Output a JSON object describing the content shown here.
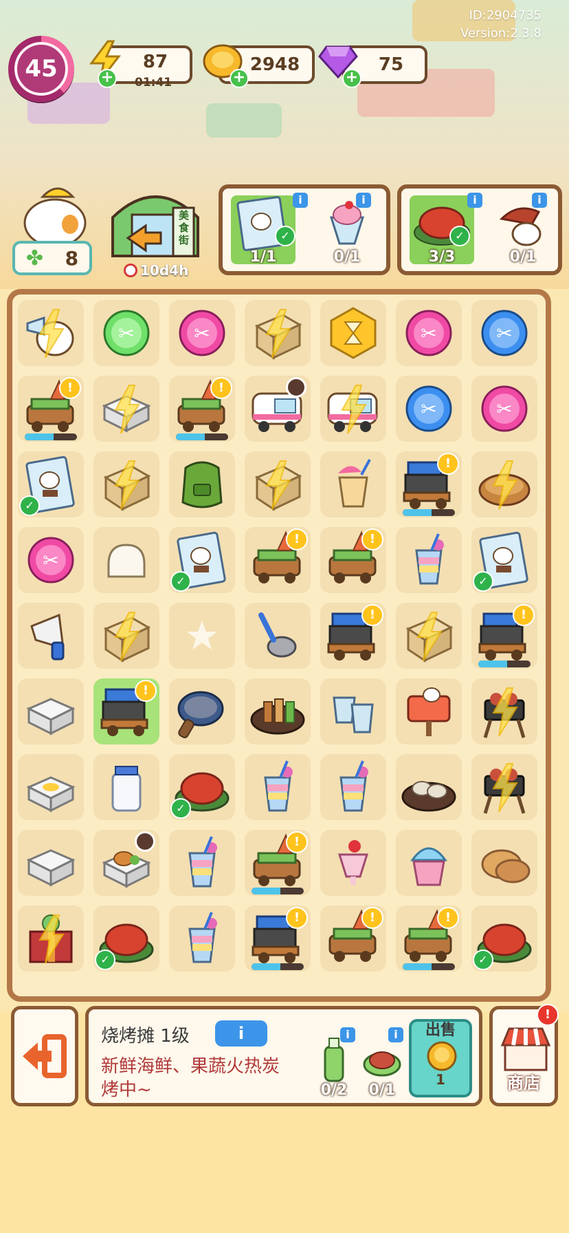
{
  "meta": {
    "player_id": "ID:2904735",
    "version": "Version:2.3.8"
  },
  "top_bar": {
    "level": "45",
    "energy": {
      "value": "87",
      "timer": "01:41"
    },
    "coins": "2948",
    "gems": "75"
  },
  "event": {
    "clover_count": "8",
    "street_label": "美食街",
    "street_timer": "10d4h"
  },
  "orders": [
    {
      "items": [
        {
          "icon": "recipe-card-icon",
          "count": "1/1",
          "complete": true
        },
        {
          "icon": "parfait-icon",
          "count": "0/1",
          "complete": false
        }
      ]
    },
    {
      "items": [
        {
          "icon": "crayfish-plate-icon",
          "count": "3/3",
          "complete": true
        },
        {
          "icon": "duck-skewer-icon",
          "count": "0/1",
          "complete": false
        }
      ]
    }
  ],
  "board": {
    "rows": [
      [
        {
          "item": "megaphone-duck",
          "energy": true
        },
        {
          "item": "green-orb"
        },
        {
          "item": "pink-orb"
        },
        {
          "item": "crate",
          "energy": true
        },
        {
          "item": "hourglass-hex"
        },
        {
          "item": "pink-orb"
        },
        {
          "item": "blue-orb"
        }
      ],
      [
        {
          "item": "bbq-cart",
          "alert": true,
          "progress": true
        },
        {
          "item": "foam-box",
          "energy": true
        },
        {
          "item": "bbq-cart",
          "alert": true,
          "progress": true
        },
        {
          "item": "food-truck",
          "clock": true
        },
        {
          "item": "food-truck",
          "energy": true
        },
        {
          "item": "blue-orb"
        },
        {
          "item": "pink-orb"
        }
      ],
      [
        {
          "item": "recipe-card",
          "check": true
        },
        {
          "item": "crate",
          "energy": true
        },
        {
          "item": "green-apron"
        },
        {
          "item": "crate",
          "energy": true
        },
        {
          "item": "iced-tea"
        },
        {
          "item": "grill-stand",
          "alert": true,
          "progress": true
        },
        {
          "item": "pie",
          "energy": true
        }
      ],
      [
        {
          "item": "pink-orb"
        },
        {
          "item": "bread"
        },
        {
          "item": "recipe-card",
          "check": true
        },
        {
          "item": "bbq-cart",
          "alert": true
        },
        {
          "item": "bbq-cart",
          "alert": true
        },
        {
          "item": "rainbow-drink"
        },
        {
          "item": "recipe-card",
          "check": true
        }
      ],
      [
        {
          "item": "megaphone"
        },
        {
          "item": "crate",
          "energy": true
        },
        {
          "item": "star-empty"
        },
        {
          "item": "ladle"
        },
        {
          "item": "grill-stand",
          "alert": true
        },
        {
          "item": "crate",
          "energy": true
        },
        {
          "item": "grill-stand",
          "alert": true,
          "progress": true
        }
      ],
      [
        {
          "item": "foam-box"
        },
        {
          "item": "grill-stand",
          "alert": true,
          "highlight": true
        },
        {
          "item": "frying-pan"
        },
        {
          "item": "skewer-plate"
        },
        {
          "item": "cups"
        },
        {
          "item": "open-sign"
        },
        {
          "item": "bbq-rack",
          "energy": true
        }
      ],
      [
        {
          "item": "foam-box-egg"
        },
        {
          "item": "milk-jar"
        },
        {
          "item": "crayfish-plate",
          "check": true
        },
        {
          "item": "rainbow-drink"
        },
        {
          "item": "rainbow-drink"
        },
        {
          "item": "oyster-plate"
        },
        {
          "item": "bbq-rack",
          "energy": true
        }
      ],
      [
        {
          "item": "foam-box"
        },
        {
          "item": "foam-box-chicken",
          "clock": true
        },
        {
          "item": "rainbow-drink"
        },
        {
          "item": "bbq-cart",
          "alert": true,
          "progress": true
        },
        {
          "item": "parfait"
        },
        {
          "item": "shaved-ice"
        },
        {
          "item": "buns"
        }
      ],
      [
        {
          "item": "gift-box",
          "energy": true
        },
        {
          "item": "crayfish-plate",
          "check": true
        },
        {
          "item": "rainbow-drink"
        },
        {
          "item": "grill-stand",
          "alert": true,
          "progress": true
        },
        {
          "item": "bbq-cart",
          "alert": true
        },
        {
          "item": "bbq-cart",
          "alert": true,
          "progress": true
        },
        {
          "item": "crayfish-plate",
          "check": true
        }
      ]
    ]
  },
  "selected_item": {
    "name": "烧烤摊 1级",
    "info_label": "i",
    "description": "新鲜海鲜、果蔬火热炭烤中~",
    "requirements": [
      {
        "icon": "green-bottle-icon",
        "count": "0/2"
      },
      {
        "icon": "meat-plate-icon",
        "count": "0/1"
      }
    ],
    "sell": {
      "label": "出售",
      "price": "1"
    }
  },
  "shop": {
    "label": "商店"
  },
  "colors": {
    "board_border": "#b47848",
    "accent_blue": "#3c95e8",
    "check_green": "#2fb24a"
  }
}
